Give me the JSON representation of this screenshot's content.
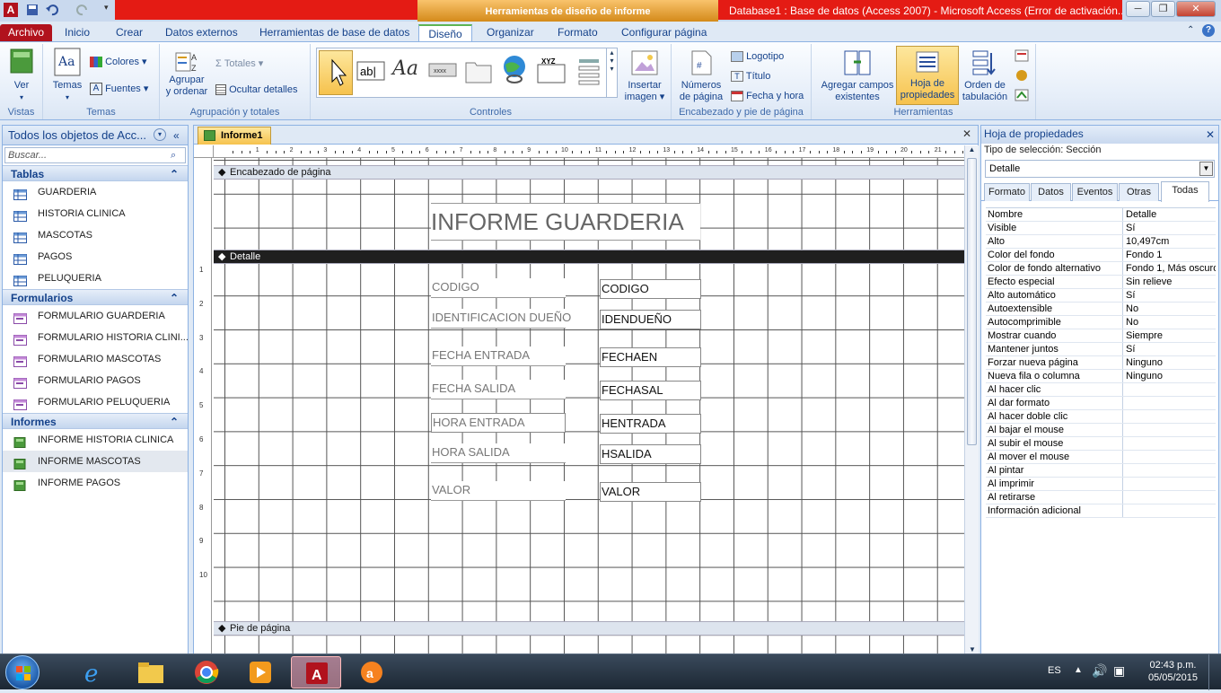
{
  "titlebar": {
    "context_title": "Herramientas de diseño de informe",
    "window_title": "Database1 : Base de datos (Access 2007)  -  Microsoft Access (Error de activación..."
  },
  "tabs": [
    "Archivo",
    "Inicio",
    "Crear",
    "Datos externos",
    "Herramientas de base de datos",
    "Diseño",
    "Organizar",
    "Formato",
    "Configurar página"
  ],
  "ribbon": {
    "vistas": {
      "ver": "Ver",
      "label": "Vistas"
    },
    "temas": {
      "temas": "Temas",
      "colores": "Colores",
      "fuentes": "Fuentes",
      "label": "Temas"
    },
    "agrupacion": {
      "agrupar1": "Agrupar",
      "agrupar2": "y ordenar",
      "totales": "Totales",
      "ocultar": "Ocultar detalles",
      "label": "Agrupación y totales"
    },
    "controles": {
      "label": "Controles",
      "insertar1": "Insertar",
      "insertar2": "imagen"
    },
    "encabezado": {
      "numeros1": "Números",
      "numeros2": "de página",
      "logotipo": "Logotipo",
      "titulo": "Título",
      "fecha": "Fecha y hora",
      "label": "Encabezado y pie de página"
    },
    "herramientas": {
      "agregar1": "Agregar campos",
      "agregar2": "existentes",
      "hoja1": "Hoja de",
      "hoja2": "propiedades",
      "orden1": "Orden de",
      "orden2": "tabulación",
      "label": "Herramientas"
    }
  },
  "nav": {
    "title": "Todos los objetos de Acc...",
    "search_placeholder": "Buscar...",
    "categories": [
      {
        "name": "Tablas",
        "items": [
          "GUARDERIA",
          "HISTORIA CLINICA",
          "MASCOTAS",
          "PAGOS",
          "PELUQUERIA"
        ]
      },
      {
        "name": "Formularios",
        "items": [
          "FORMULARIO GUARDERIA",
          "FORMULARIO HISTORIA CLINI...",
          "FORMULARIO MASCOTAS",
          "FORMULARIO PAGOS",
          "FORMULARIO PELUQUERIA"
        ]
      },
      {
        "name": "Informes",
        "items": [
          "INFORME HISTORIA CLINICA",
          "INFORME MASCOTAS",
          "INFORME PAGOS"
        ]
      }
    ]
  },
  "doc": {
    "tab": "Informe1",
    "sections": {
      "header": "Encabezado de página",
      "detail": "Detalle",
      "footer": "Pie de página"
    },
    "report_title": "INFORME GUARDERIA",
    "fields": [
      {
        "label": "CODIGO",
        "control": "CODIGO"
      },
      {
        "label": "IDENTIFICACION DUEÑO",
        "control": "IDENDUEÑO"
      },
      {
        "label": "FECHA ENTRADA",
        "control": "FECHAEN"
      },
      {
        "label": "FECHA SALIDA",
        "control": "FECHASAL"
      },
      {
        "label": "HORA ENTRADA",
        "control": "HENTRADA"
      },
      {
        "label": "HORA SALIDA",
        "control": "HSALIDA"
      },
      {
        "label": "VALOR",
        "control": "VALOR"
      }
    ],
    "ruler_numbers": [
      "1",
      "2",
      "3",
      "4",
      "5",
      "6",
      "7",
      "8",
      "9",
      "10",
      "11",
      "12",
      "13",
      "14",
      "15",
      "16",
      "17",
      "18",
      "19",
      "20",
      "21",
      "22"
    ],
    "vruler_numbers": [
      "1",
      "2",
      "3",
      "4",
      "5",
      "6",
      "7",
      "8",
      "9",
      "10"
    ]
  },
  "props": {
    "title": "Hoja de propiedades",
    "selection_type": "Tipo de selección:  Sección",
    "selected": "Detalle",
    "tabs": [
      "Formato",
      "Datos",
      "Eventos",
      "Otras",
      "Todas"
    ],
    "rows": [
      [
        "Nombre",
        "Detalle"
      ],
      [
        "Visible",
        "Sí"
      ],
      [
        "Alto",
        "10,497cm"
      ],
      [
        "Color del fondo",
        "Fondo 1"
      ],
      [
        "Color de fondo alternativo",
        "Fondo 1, Más oscuro"
      ],
      [
        "Efecto especial",
        "Sin relieve"
      ],
      [
        "Alto automático",
        "Sí"
      ],
      [
        "Autoextensible",
        "No"
      ],
      [
        "Autocomprimible",
        "No"
      ],
      [
        "Mostrar cuando",
        "Siempre"
      ],
      [
        "Mantener juntos",
        "Sí"
      ],
      [
        "Forzar nueva página",
        "Ninguno"
      ],
      [
        "Nueva fila o columna",
        "Ninguno"
      ],
      [
        "Al hacer clic",
        ""
      ],
      [
        "Al dar formato",
        ""
      ],
      [
        "Al hacer doble clic",
        ""
      ],
      [
        "Al bajar el mouse",
        ""
      ],
      [
        "Al subir el mouse",
        ""
      ],
      [
        "Al mover el mouse",
        ""
      ],
      [
        "Al pintar",
        ""
      ],
      [
        "Al imprimir",
        ""
      ],
      [
        "Al retirarse",
        ""
      ],
      [
        "Información adicional",
        ""
      ]
    ]
  },
  "taskbar": {
    "lang": "ES",
    "time": "02:43 p.m.",
    "date": "05/05/2015"
  }
}
